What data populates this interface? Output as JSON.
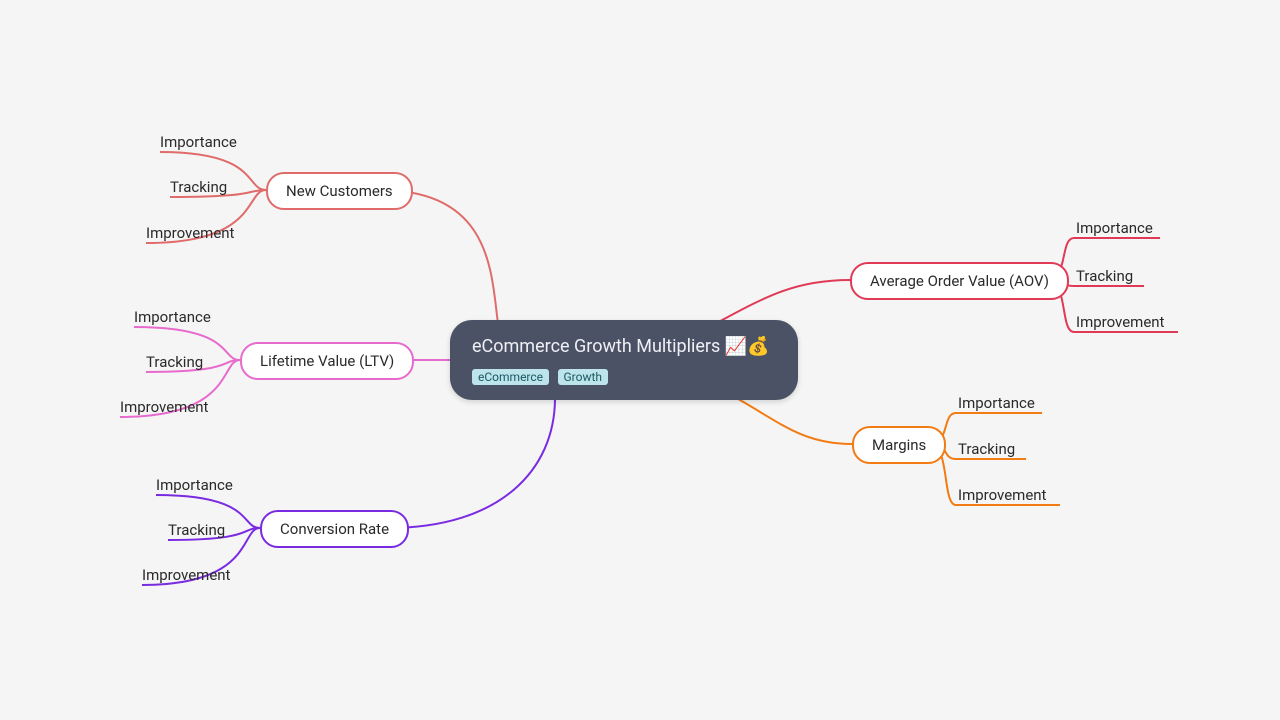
{
  "root": {
    "title": "eCommerce Growth Multipliers 📈💰",
    "tags": [
      "eCommerce",
      "Growth"
    ]
  },
  "branches": {
    "new_customers": {
      "label": "New Customers",
      "color": "#e06b6b"
    },
    "ltv": {
      "label": "Lifetime Value (LTV)",
      "color": "#e76bce"
    },
    "conversion": {
      "label": "Conversion Rate",
      "color": "#7a2be2"
    },
    "aov": {
      "label": "Average Order Value (AOV)",
      "color": "#e03a57"
    },
    "margins": {
      "label": "Margins",
      "color": "#f27b13"
    }
  },
  "leaf_labels": {
    "importance": "Importance",
    "tracking": "Tracking",
    "improvement": "Improvement"
  }
}
